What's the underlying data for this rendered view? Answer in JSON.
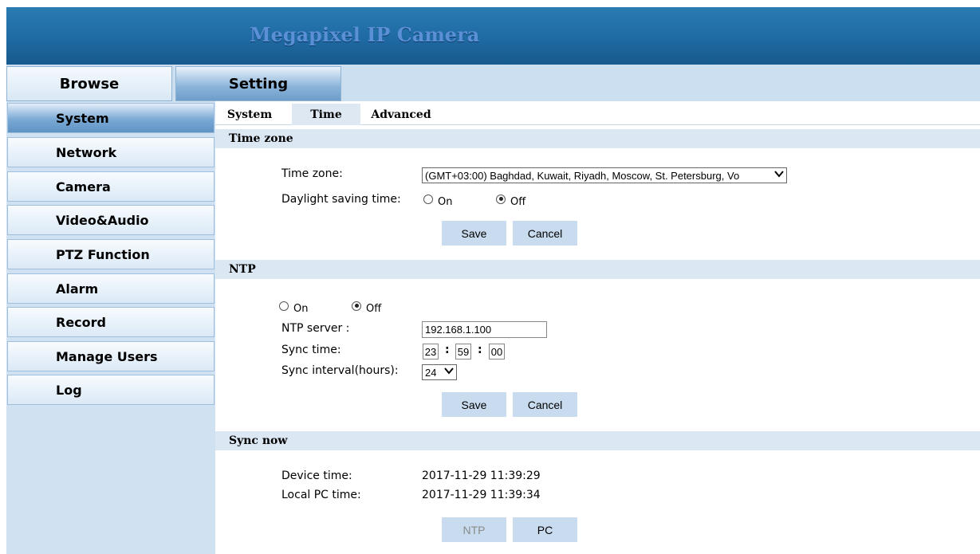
{
  "header": {
    "title": "Megapixel IP Camera"
  },
  "topnav": [
    {
      "label": "Browse",
      "active": false
    },
    {
      "label": "Setting",
      "active": true
    }
  ],
  "sidebar": {
    "items": [
      {
        "label": "System",
        "active": true
      },
      {
        "label": "Network"
      },
      {
        "label": "Camera"
      },
      {
        "label": "Video&Audio"
      },
      {
        "label": "PTZ Function"
      },
      {
        "label": "Alarm"
      },
      {
        "label": "Record"
      },
      {
        "label": "Manage Users"
      },
      {
        "label": "Log"
      }
    ]
  },
  "tabs": [
    {
      "label": "System"
    },
    {
      "label": "Time",
      "active": true
    },
    {
      "label": "Advanced"
    }
  ],
  "timezone_section": {
    "heading": "Time zone",
    "timezone_label": "Time zone:",
    "timezone_value": "(GMT+03:00) Baghdad, Kuwait, Riyadh, Moscow, St. Petersburg, Vo",
    "dst_label": "Daylight saving time:",
    "dst_on": "On",
    "dst_off": "Off",
    "dst_selected": "Off",
    "save": "Save",
    "cancel": "Cancel"
  },
  "ntp_section": {
    "heading": "NTP",
    "on": "On",
    "off": "Off",
    "selected": "Off",
    "server_label": "NTP server :",
    "server_value": "192.168.1.100",
    "sync_time_label": "Sync time:",
    "sync_hh": "23",
    "sync_mm": "59",
    "sync_ss": "00",
    "sync_sep": ":",
    "interval_label": "Sync interval(hours):",
    "interval_value": "24",
    "save": "Save",
    "cancel": "Cancel"
  },
  "sync_section": {
    "heading": "Sync now",
    "device_label": "Device time:",
    "device_value": "2017-11-29 11:39:29",
    "pc_label": "Local PC time:",
    "pc_value": "2017-11-29 11:39:34",
    "ntp_button": "NTP",
    "pc_button": "PC"
  },
  "icons": {
    "dropdown": "chevron-down-icon",
    "radio": "radio-icon"
  }
}
